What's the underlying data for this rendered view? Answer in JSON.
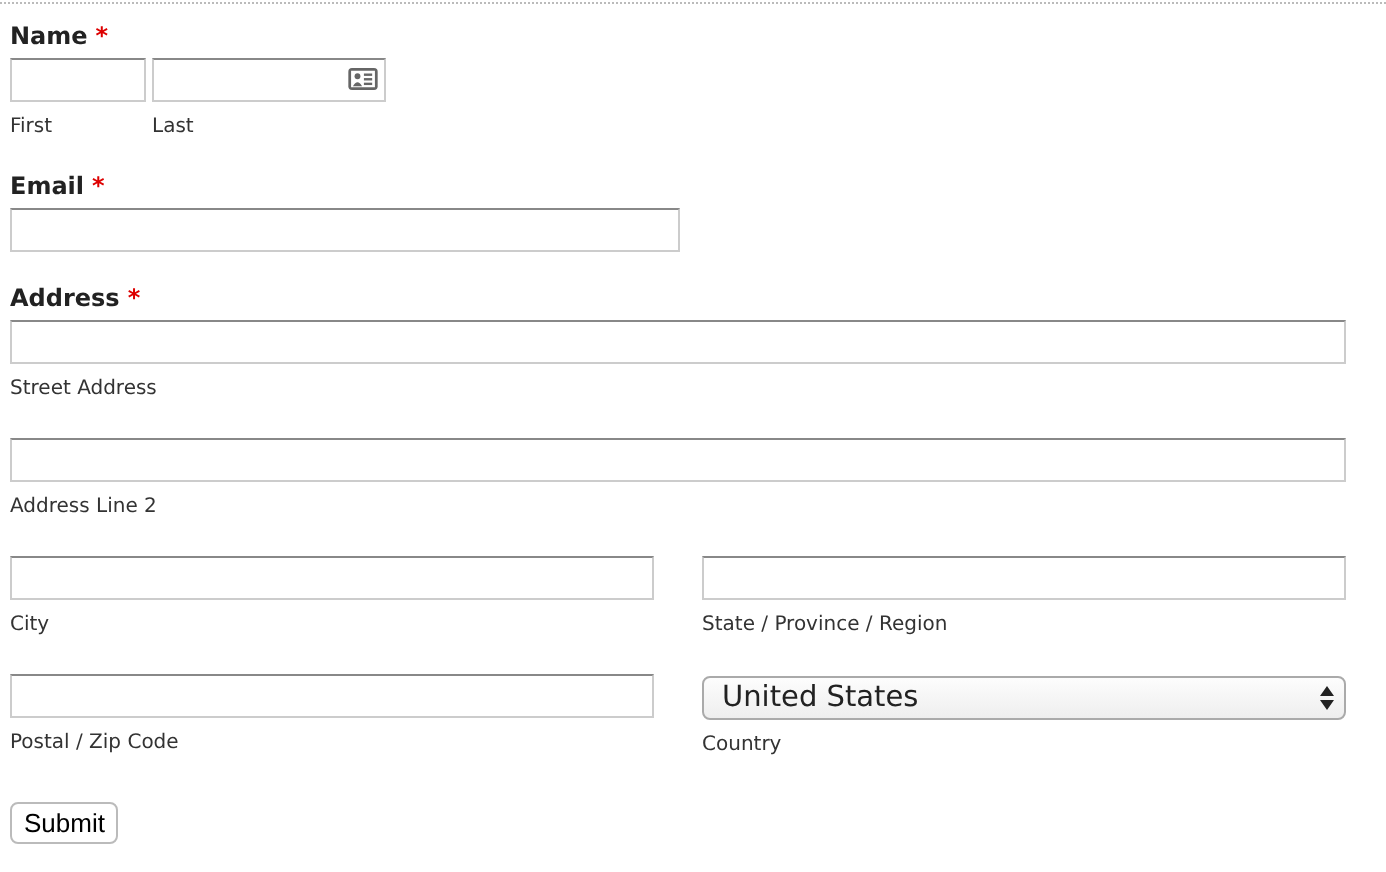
{
  "fields": [
    {
      "kind": "name",
      "label": "Name",
      "required_mark": "*",
      "parts": [
        {
          "sublabel": "First",
          "card_icon": false
        },
        {
          "sublabel": "Last",
          "card_icon": true
        }
      ]
    },
    {
      "kind": "email",
      "label": "Email",
      "required_mark": "*"
    },
    {
      "kind": "address",
      "label": "Address",
      "required_mark": "*",
      "rows": [
        [
          {
            "kind": "text",
            "sublabel": "Street Address"
          }
        ],
        [
          {
            "kind": "text",
            "sublabel": "Address Line 2"
          }
        ],
        [
          {
            "kind": "text",
            "sublabel": "City"
          },
          {
            "kind": "text",
            "sublabel": "State / Province / Region"
          }
        ],
        [
          {
            "kind": "text",
            "sublabel": "Postal / Zip Code"
          },
          {
            "kind": "select",
            "value": "United States",
            "sublabel": "Country"
          }
        ]
      ]
    }
  ],
  "submit": "Submit"
}
